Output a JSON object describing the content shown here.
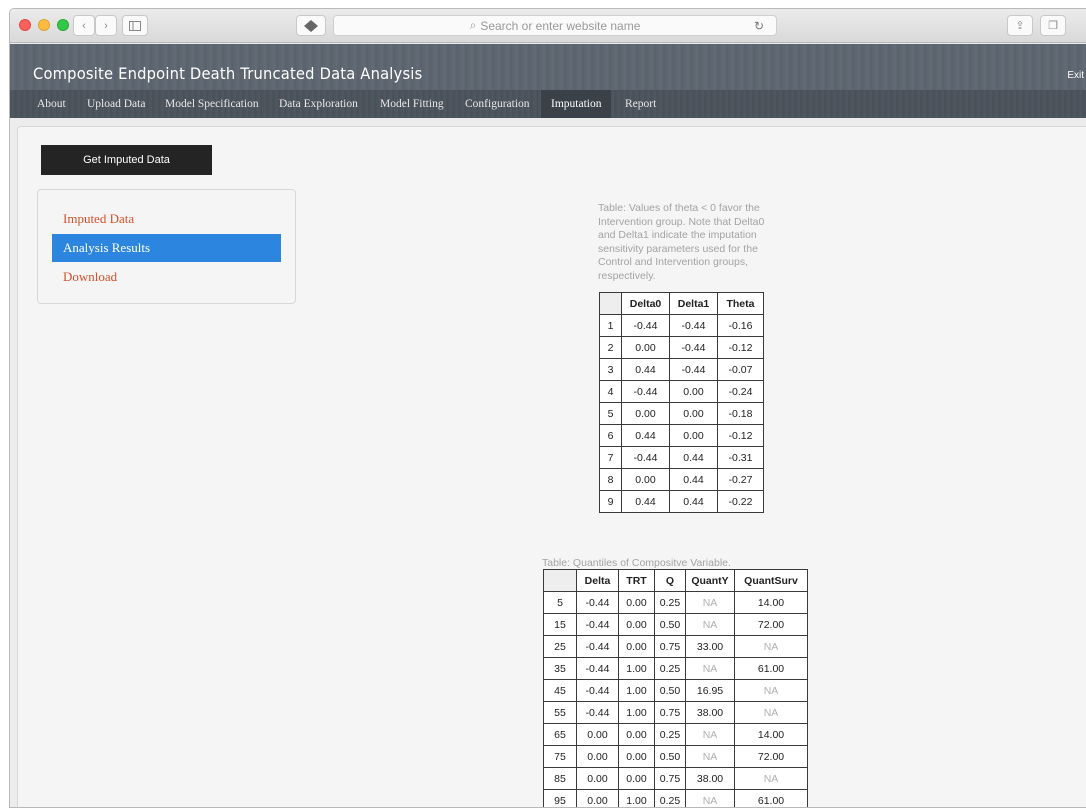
{
  "browser": {
    "address_placeholder": "Search or enter website name"
  },
  "app": {
    "title": "Composite Endpoint Death Truncated Data Analysis",
    "exit_label": "Exit"
  },
  "nav": {
    "items": [
      "About",
      "Upload Data",
      "Model Specification",
      "Data Exploration",
      "Model Fitting",
      "Configuration",
      "Imputation",
      "Report"
    ],
    "active": "Imputation"
  },
  "actions": {
    "get_imputed_label": "Get Imputed Data"
  },
  "sidebar": {
    "items": [
      "Imputed Data",
      "Analysis Results",
      "Download"
    ],
    "active": "Analysis Results"
  },
  "table1": {
    "caption": "Table: Values of theta < 0 favor the Intervention group. Note that Delta0 and Delta1 indicate the imputation sensitivity parameters used for the Control and Intervention groups, respectively.",
    "headers": [
      "",
      "Delta0",
      "Delta1",
      "Theta"
    ],
    "rows": [
      [
        "1",
        "-0.44",
        "-0.44",
        "-0.16"
      ],
      [
        "2",
        "0.00",
        "-0.44",
        "-0.12"
      ],
      [
        "3",
        "0.44",
        "-0.44",
        "-0.07"
      ],
      [
        "4",
        "-0.44",
        "0.00",
        "-0.24"
      ],
      [
        "5",
        "0.00",
        "0.00",
        "-0.18"
      ],
      [
        "6",
        "0.44",
        "0.00",
        "-0.12"
      ],
      [
        "7",
        "-0.44",
        "0.44",
        "-0.31"
      ],
      [
        "8",
        "0.00",
        "0.44",
        "-0.27"
      ],
      [
        "9",
        "0.44",
        "0.44",
        "-0.22"
      ]
    ]
  },
  "table2": {
    "caption": "Table: Quantiles of Compositve Variable.",
    "headers": [
      "",
      "Delta",
      "TRT",
      "Q",
      "QuantY",
      "QuantSurv"
    ],
    "rows": [
      [
        "5",
        "-0.44",
        "0.00",
        "0.25",
        "NA",
        "14.00"
      ],
      [
        "15",
        "-0.44",
        "0.00",
        "0.50",
        "NA",
        "72.00"
      ],
      [
        "25",
        "-0.44",
        "0.00",
        "0.75",
        "33.00",
        "NA"
      ],
      [
        "35",
        "-0.44",
        "1.00",
        "0.25",
        "NA",
        "61.00"
      ],
      [
        "45",
        "-0.44",
        "1.00",
        "0.50",
        "16.95",
        "NA"
      ],
      [
        "55",
        "-0.44",
        "1.00",
        "0.75",
        "38.00",
        "NA"
      ],
      [
        "65",
        "0.00",
        "0.00",
        "0.25",
        "NA",
        "14.00"
      ],
      [
        "75",
        "0.00",
        "0.00",
        "0.50",
        "NA",
        "72.00"
      ],
      [
        "85",
        "0.00",
        "0.00",
        "0.75",
        "38.00",
        "NA"
      ],
      [
        "95",
        "0.00",
        "1.00",
        "0.25",
        "NA",
        "61.00"
      ]
    ]
  }
}
